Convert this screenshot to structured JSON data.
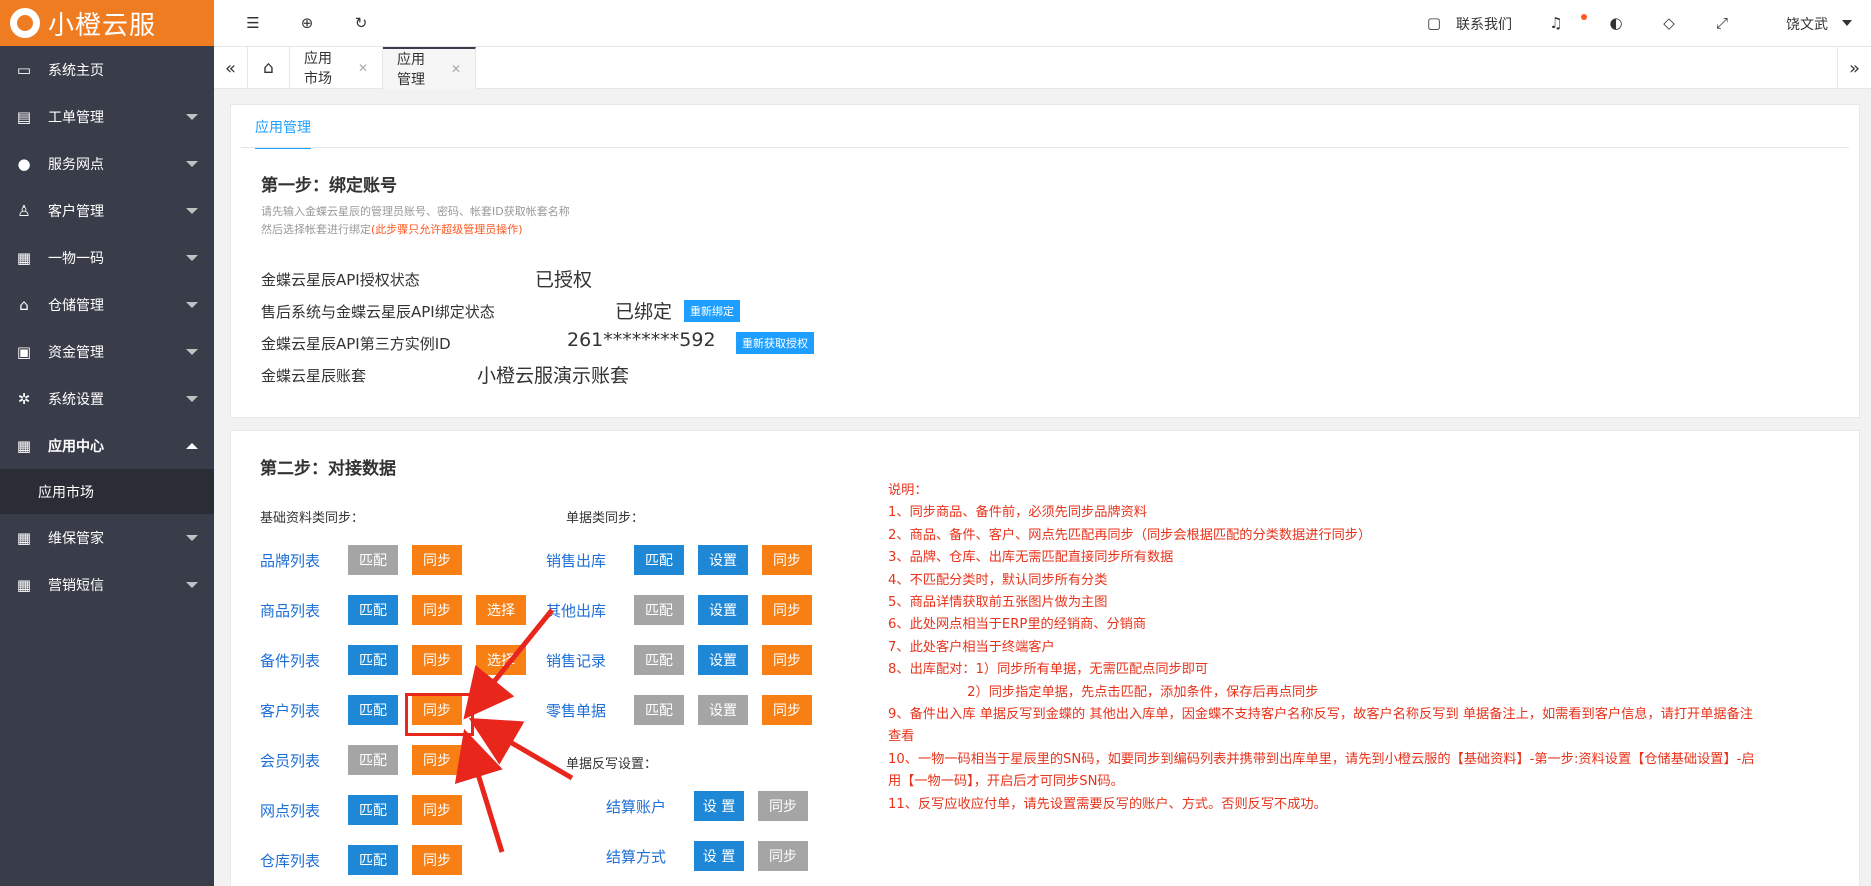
{
  "brand": {
    "logo_text": "小橙云服"
  },
  "sidebar": {
    "items": [
      {
        "label": "系统主页",
        "icon": "monitor-icon",
        "glyph": "▭",
        "caret": false
      },
      {
        "label": "工单管理",
        "icon": "document-icon",
        "glyph": "▤",
        "caret": true
      },
      {
        "label": "服务网点",
        "icon": "globe-icon",
        "glyph": "●",
        "caret": true
      },
      {
        "label": "客户管理",
        "icon": "user-icon",
        "glyph": "♙",
        "caret": true
      },
      {
        "label": "一物一码",
        "icon": "grid-icon",
        "glyph": "▦",
        "caret": true
      },
      {
        "label": "仓储管理",
        "icon": "bank-icon",
        "glyph": "⌂",
        "caret": true
      },
      {
        "label": "资金管理",
        "icon": "money-icon",
        "glyph": "▣",
        "caret": true
      },
      {
        "label": "系统设置",
        "icon": "gear-icon",
        "glyph": "✲",
        "caret": true
      },
      {
        "label": "应用中心",
        "icon": "grid-icon",
        "glyph": "▦",
        "caret": "up"
      }
    ],
    "sub_item": "应用市场",
    "items_after": [
      {
        "label": "维保管家",
        "icon": "grid-icon",
        "glyph": "▦",
        "caret": true
      },
      {
        "label": "营销短信",
        "icon": "grid-icon",
        "glyph": "▦",
        "caret": true
      }
    ]
  },
  "topbar": {
    "contact_label": "联系我们",
    "user_name": "饶文武"
  },
  "tabs": {
    "items": [
      {
        "label": "应用市场"
      },
      {
        "label": "应用管理"
      }
    ]
  },
  "panel1": {
    "inner_tab": "应用管理",
    "step_title": "第一步：绑定账号",
    "hint_line1": "请先输入金蝶云星辰的管理员账号、密码、帐套ID获取帐套名称",
    "hint_line2": "然后选择帐套进行绑定",
    "hint_red": "(此步骤只允许超级管理员操作)",
    "rows": [
      {
        "label": "金蝶云星辰API授权状态",
        "value": "已授权"
      },
      {
        "label": "售后系统与金蝶云星辰API绑定状态",
        "value": "已绑定",
        "button": "重新绑定"
      },
      {
        "label": "金蝶云星辰API第三方实例ID",
        "value": "261********592",
        "button": "重新获取授权"
      },
      {
        "label": "金蝶云星辰账套",
        "value": "小橙云服演示账套"
      }
    ]
  },
  "panel2": {
    "step_title": "第二步：对接数据",
    "basic_label": "基础资料类同步：",
    "doc_label": "单据类同步：",
    "writeback_label": "单据反写设置：",
    "basic_rows": [
      {
        "label": "品牌列表",
        "buttons": [
          {
            "t": "匹配",
            "c": "gray"
          },
          {
            "t": "同步",
            "c": "orange"
          }
        ]
      },
      {
        "label": "商品列表",
        "buttons": [
          {
            "t": "匹配",
            "c": "blue"
          },
          {
            "t": "同步",
            "c": "orange"
          },
          {
            "t": "选择",
            "c": "orange"
          }
        ]
      },
      {
        "label": "备件列表",
        "buttons": [
          {
            "t": "匹配",
            "c": "blue"
          },
          {
            "t": "同步",
            "c": "orange"
          },
          {
            "t": "选择",
            "c": "orange"
          }
        ]
      },
      {
        "label": "客户列表",
        "buttons": [
          {
            "t": "匹配",
            "c": "blue"
          },
          {
            "t": "同步",
            "c": "orange"
          }
        ]
      },
      {
        "label": "会员列表",
        "buttons": [
          {
            "t": "匹配",
            "c": "gray"
          },
          {
            "t": "同步",
            "c": "orange"
          }
        ]
      },
      {
        "label": "网点列表",
        "buttons": [
          {
            "t": "匹配",
            "c": "blue"
          },
          {
            "t": "同步",
            "c": "orange"
          }
        ]
      },
      {
        "label": "仓库列表",
        "buttons": [
          {
            "t": "匹配",
            "c": "blue"
          },
          {
            "t": "同步",
            "c": "orange"
          }
        ]
      }
    ],
    "doc_rows": [
      {
        "label": "销售出库",
        "buttons": [
          {
            "t": "匹配",
            "c": "blue"
          },
          {
            "t": "设置",
            "c": "blue"
          },
          {
            "t": "同步",
            "c": "orange"
          }
        ]
      },
      {
        "label": "其他出库",
        "buttons": [
          {
            "t": "匹配",
            "c": "gray"
          },
          {
            "t": "设置",
            "c": "blue"
          },
          {
            "t": "同步",
            "c": "orange"
          }
        ]
      },
      {
        "label": "销售记录",
        "buttons": [
          {
            "t": "匹配",
            "c": "gray"
          },
          {
            "t": "设置",
            "c": "blue"
          },
          {
            "t": "同步",
            "c": "orange"
          }
        ]
      },
      {
        "label": "零售单据",
        "buttons": [
          {
            "t": "匹配",
            "c": "gray"
          },
          {
            "t": "设置",
            "c": "gray"
          },
          {
            "t": "同步",
            "c": "orange"
          }
        ]
      }
    ],
    "writeback_rows": [
      {
        "label": "结算账户",
        "buttons": [
          {
            "t": "设 置",
            "c": "blue"
          },
          {
            "t": "同步",
            "c": "gray"
          }
        ]
      },
      {
        "label": "结算方式",
        "buttons": [
          {
            "t": "设 置",
            "c": "blue"
          },
          {
            "t": "同步",
            "c": "gray"
          }
        ]
      }
    ],
    "notes": [
      "说明：",
      "1、同步商品、备件前，必须先同步品牌资料",
      "2、商品、备件、客户、网点先匹配再同步（同步会根据匹配的分类数据进行同步）",
      "3、品牌、仓库、出库无需匹配直接同步所有数据",
      "4、不匹配分类时，默认同步所有分类",
      "5、商品详情获取前五张图片做为主图",
      "6、此处网点相当于ERP里的经销商、分销商",
      "7、此处客户相当于终端客户",
      "8、出库配对：1）同步所有单据，无需匹配点同步即可",
      "　　　　　　2）同步指定单据，先点击匹配，添加条件，保存后再点同步",
      "9、备件出入库 单据反写到金蝶的 其他出入库单，因金蝶不支持客户名称反写，故客户名称反写到 单据备注上，如需看到客户信息，请打开单据备注查看",
      "10、一物一码相当于星辰里的SN码，如要同步到编码列表并携带到出库单里，请先到小橙云服的【基础资料】-第一步:资料设置【仓储基础设置】-启用【一物一码】，开启后才可同步SN码。",
      "11、反写应收应付单，请先设置需要反写的账户、方式。否则反写不成功。"
    ]
  },
  "colors": {
    "brand": "#f07c22",
    "sidebar": "#393d49",
    "blue": "#1e88d6",
    "orange": "#f77f14",
    "gray": "#a5a5a5",
    "note_red": "#e8331c"
  }
}
